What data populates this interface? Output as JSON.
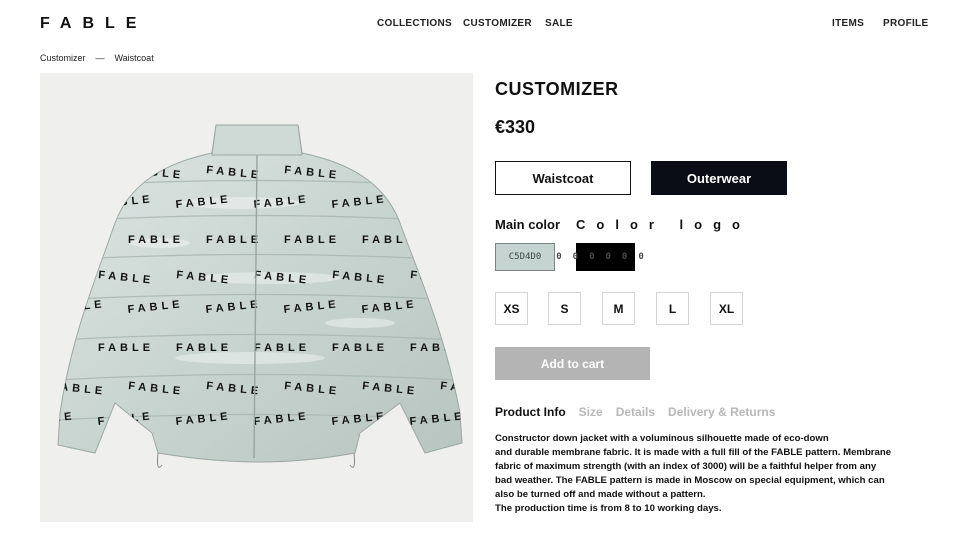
{
  "header": {
    "logo": "FABLE",
    "nav": {
      "collections": "COLLECTIONS",
      "customizer": "CUSTOMIZER",
      "sale": "SALE",
      "items": "ITEMS",
      "profile": "PROFILE"
    }
  },
  "breadcrumb": {
    "root": "Customizer",
    "separator": "—",
    "current": "Waistcoat"
  },
  "product": {
    "title": "CUSTOMIZER",
    "price": "€330",
    "types": [
      "Waistcoat",
      "Outerwear"
    ],
    "selected_type": "Outerwear",
    "colors": {
      "main_label": "Main color",
      "logo_label": "Color logo",
      "main_value": "C5D4D0",
      "logo_value": "000000",
      "main_hex": "#c5d4d0",
      "logo_hex": "#000000"
    },
    "sizes": [
      "XS",
      "S",
      "M",
      "L",
      "XL"
    ],
    "add_to_cart": "Add to cart",
    "tabs": [
      "Product Info",
      "Size",
      "Details",
      "Delivery & Returns"
    ],
    "active_tab": "Product Info",
    "description_lines": [
      "Constructor down jacket with a voluminous silhouette made of eco-down",
      "and durable membrane fabric. It is made with a full fill of the FABLE pattern. Membrane",
      "fabric of maximum strength (with an index of 3000) will be a faithful helper from any",
      "bad weather. The FABLE pattern is made in Moscow on special equipment, which can",
      "also be turned off and made without a pattern.",
      "The production time is from 8 to 10 working days."
    ],
    "image": {
      "icon": "puffer-jacket-image",
      "pattern_text": "FABLE"
    }
  }
}
